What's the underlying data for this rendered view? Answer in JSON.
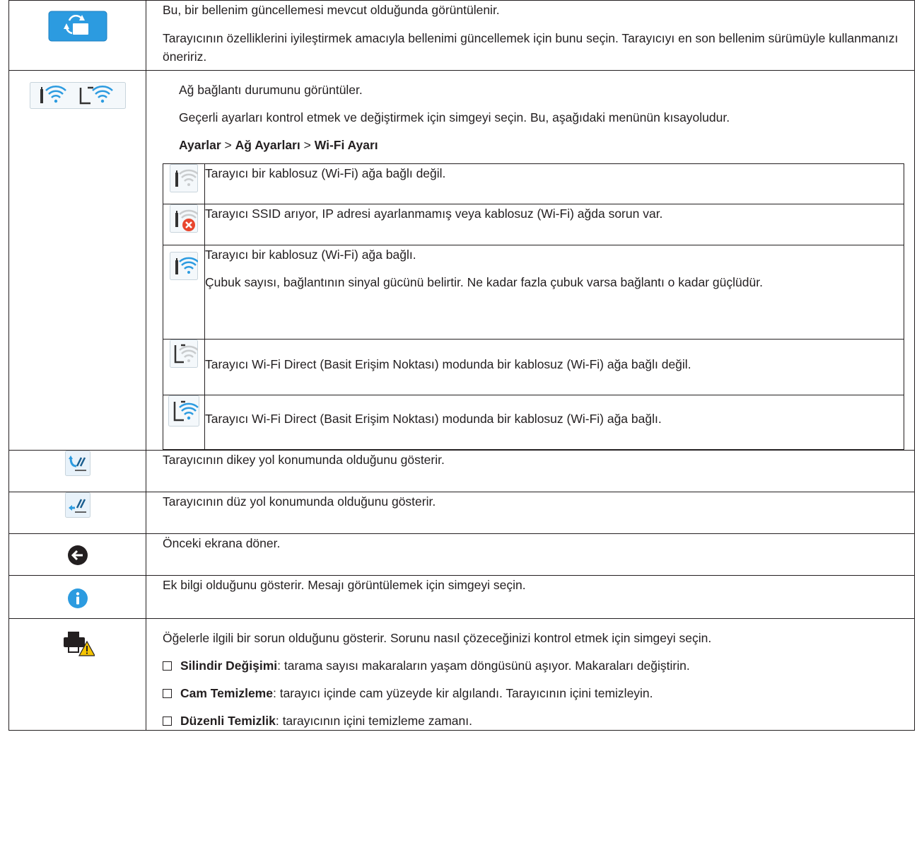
{
  "firmware": {
    "line1": "Bu, bir bellenim güncellemesi mevcut olduğunda görüntülenir.",
    "line2": "Tarayıcının özelliklerini iyileştirmek amacıyla bellenimi güncellemek için bunu seçin. Tarayıcıyı en son bellenim sürümüyle kullanmanızı öneririz."
  },
  "network": {
    "line1": "Ağ bağlantı durumunu görüntüler.",
    "line2": "Geçerli ayarları kontrol etmek ve değiştirmek için simgeyi seçin. Bu, aşağıdaki menünün kısayoludur.",
    "path": [
      "Ayarlar",
      "Ağ Ayarları",
      "Wi-Fi Ayarı"
    ],
    "sep": ">",
    "states": [
      {
        "icon": "wifi-disconnected-icon",
        "text": "Tarayıcı bir kablosuz (Wi-Fi) ağa bağlı değil."
      },
      {
        "icon": "wifi-error-icon",
        "text": "Tarayıcı SSID arıyor, IP adresi ayarlanmamış veya kablosuz (Wi-Fi) ağda sorun var."
      },
      {
        "icon": "wifi-connected-icon",
        "text": "Tarayıcı bir kablosuz (Wi-Fi) ağa bağlı.",
        "text2": "Çubuk sayısı, bağlantının sinyal gücünü belirtir. Ne kadar fazla çubuk varsa bağlantı o kadar güçlüdür."
      },
      {
        "icon": "wifi-direct-disconnected-icon",
        "text": "Tarayıcı Wi-Fi Direct (Basit Erişim Noktası) modunda bir kablosuz (Wi-Fi) ağa bağlı değil."
      },
      {
        "icon": "wifi-direct-connected-icon",
        "text": "Tarayıcı Wi-Fi Direct (Basit Erişim Noktası) modunda bir kablosuz (Wi-Fi) ağa bağlı."
      }
    ]
  },
  "vertical_path": "Tarayıcının dikey yol konumunda olduğunu gösterir.",
  "straight_path": "Tarayıcının düz yol konumunda olduğunu gösterir.",
  "back": "Önceki ekrana döner.",
  "info": "Ek bilgi olduğunu gösterir. Mesajı görüntülemek için simgeyi seçin.",
  "problem": {
    "line1": "Öğelerle ilgili bir sorun olduğunu gösterir. Sorunu nasıl çözeceğinizi kontrol etmek için simgeyi seçin.",
    "items": [
      {
        "term": "Silindir Değişimi",
        "desc": ": tarama sayısı makaraların yaşam döngüsünü aşıyor. Makaraları değiştirin."
      },
      {
        "term": "Cam Temizleme",
        "desc": ": tarayıcı içinde cam yüzeyde kir algılandı. Tarayıcının içini temizleyin."
      },
      {
        "term": "Düzenli Temizlik",
        "desc": ": tarayıcının içini temizleme zamanı."
      }
    ]
  },
  "colors": {
    "accent_blue": "#2c9be0",
    "text": "#231f20",
    "warning_yellow": "#f5c400",
    "error_red": "#e8462e"
  }
}
